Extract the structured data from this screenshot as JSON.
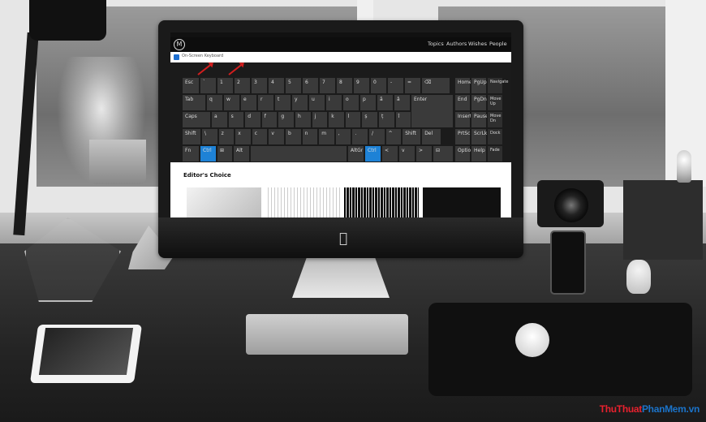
{
  "site": {
    "nav": [
      "Topics",
      "Authors",
      "Wishes",
      "People"
    ],
    "logo_letter": "M",
    "section_title": "Editor's Choice"
  },
  "on_screen_keyboard": {
    "title": "On-Screen Keyboard",
    "highlight_color": "#1e82d6",
    "annotation_color": "#d21e1e",
    "row1": [
      "Esc",
      "`",
      "1",
      "2",
      "3",
      "4",
      "5",
      "6",
      "7",
      "8",
      "9",
      "0",
      "-",
      "=",
      "⌫"
    ],
    "row2": [
      "Tab",
      "q",
      "w",
      "e",
      "r",
      "t",
      "y",
      "u",
      "i",
      "o",
      "p",
      "ă",
      "â"
    ],
    "row3": [
      "Caps",
      "a",
      "s",
      "d",
      "f",
      "g",
      "h",
      "j",
      "k",
      "l",
      "ș",
      "ț",
      "î"
    ],
    "row4": [
      "Shift",
      "\\",
      "z",
      "x",
      "c",
      "v",
      "b",
      "n",
      "m",
      ",",
      ".",
      "/",
      "^",
      "Shift",
      "Del"
    ],
    "row5": [
      "Fn",
      "Ctrl",
      "⊞",
      "Alt",
      "",
      "AltGr",
      "Ctrl",
      "<",
      "v",
      ">",
      "⊟"
    ],
    "enter": "Enter",
    "side_keys": [
      [
        "Home",
        "PgUp",
        "Navigate"
      ],
      [
        "End",
        "PgDn",
        "Move Up"
      ],
      [
        "Insert",
        "Pause",
        "Move Dn"
      ],
      [
        "PrtScn",
        "ScrLk",
        "Dock"
      ],
      [
        "Options",
        "Help",
        "Fade"
      ]
    ]
  },
  "watermark": {
    "part1": "ThuThuat",
    "part2": "PhanMem",
    "part3": ".vn"
  }
}
